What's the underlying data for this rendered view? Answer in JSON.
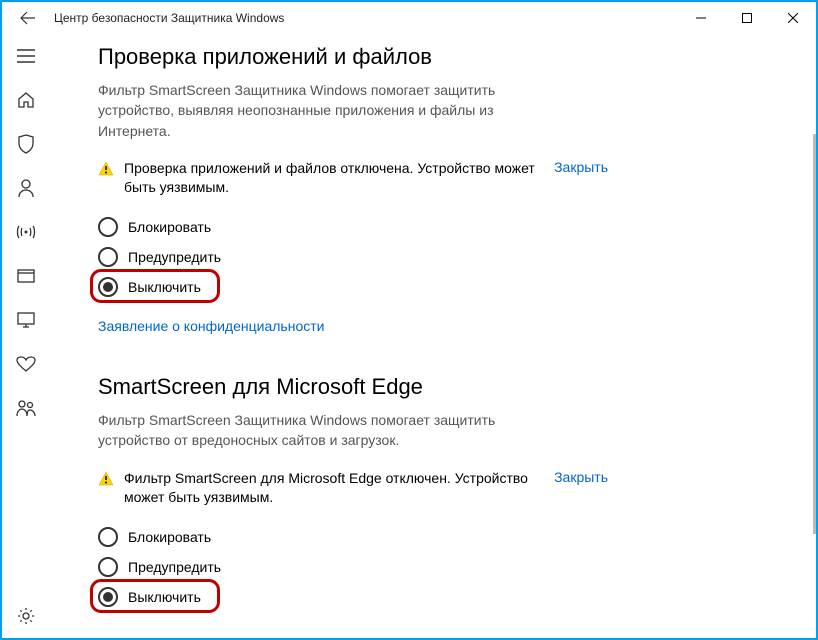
{
  "window": {
    "title": "Центр безопасности Защитника Windows"
  },
  "sections": {
    "apps": {
      "heading": "Проверка приложений и файлов",
      "description": "Фильтр SmartScreen Защитника Windows помогает защитить устройство, выявляя неопознанные приложения и файлы из Интернета.",
      "alert_text": "Проверка приложений и файлов отключена. Устройство может быть уязвимым.",
      "alert_close": "Закрыть",
      "radio_block": "Блокировать",
      "radio_warn": "Предупредить",
      "radio_off": "Выключить",
      "privacy_link": "Заявление о конфиденциальности"
    },
    "edge": {
      "heading": "SmartScreen для Microsoft Edge",
      "description": "Фильтр SmartScreen Защитника Windows помогает защитить устройство от вредоносных сайтов и загрузок.",
      "alert_text": "Фильтр SmartScreen для Microsoft Edge отключен. Устройство может быть уязвимым.",
      "alert_close": "Закрыть",
      "radio_block": "Блокировать",
      "radio_warn": "Предупредить",
      "radio_off": "Выключить"
    }
  }
}
